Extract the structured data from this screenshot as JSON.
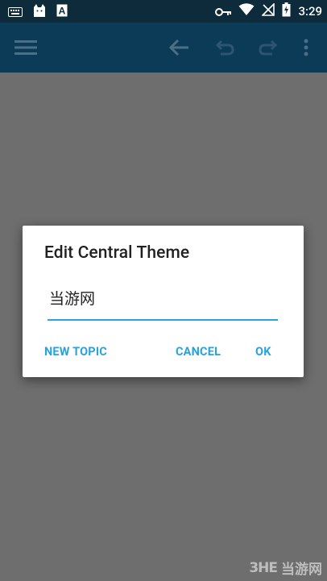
{
  "status_bar": {
    "time": "3:29",
    "icons": [
      "keyboard-icon",
      "cat-icon",
      "a-badge-icon",
      "key-icon",
      "wifi-icon",
      "no-sim-icon",
      "battery-icon"
    ]
  },
  "toolbar": {
    "icons": [
      "menu-icon",
      "back-arrow-icon",
      "undo-icon",
      "redo-icon",
      "more-vert-icon"
    ]
  },
  "dialog": {
    "title": "Edit Central Theme",
    "input_value": "当游网",
    "buttons": {
      "new_topic": "NEW TOPIC",
      "cancel": "CANCEL",
      "ok": "OK"
    }
  },
  "watermark": {
    "logo": "3HE",
    "text": "当游网"
  },
  "colors": {
    "status_bar": "#0d2b3a",
    "toolbar": "#0b3b57",
    "scrim_background": "#6e6e6e",
    "accent": "#2aa3d9"
  }
}
